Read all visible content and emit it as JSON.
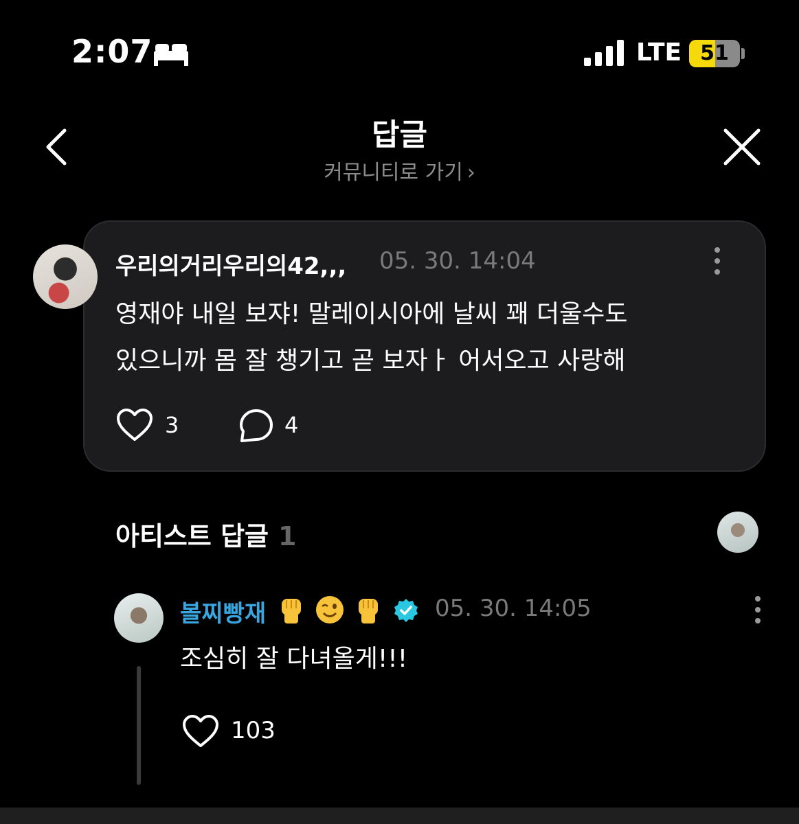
{
  "status_bar": {
    "time": "2:07",
    "network": "LTE",
    "battery": "51",
    "battery_level": 0.51,
    "icons": [
      "bed-icon",
      "signal-icon",
      "battery-icon"
    ]
  },
  "header": {
    "title": "답글",
    "subtitle": "커뮤니티로 가기",
    "subtitle_chevron": "›",
    "icons": [
      "back-icon",
      "close-icon"
    ]
  },
  "comment": {
    "username": "우리의거리우리의42,,,",
    "timestamp": "05. 30. 14:04",
    "body_line1": "영재야 내일 보쟈! 말레이시아에 날씨 꽤 더울수도",
    "body_line2": "있으니까 몸 잘 챙기고 곧 보자ㅏ 어서오고 사랑해",
    "likes": "3",
    "replies": "4"
  },
  "artist_section": {
    "title": "아티스트 답글",
    "count": "1"
  },
  "artist_reply": {
    "username": "볼찌빵재",
    "emojis": [
      "fist-emoji",
      "wink-emoji",
      "fist-emoji"
    ],
    "timestamp": "05. 30. 14:05",
    "body": "조심히 잘 다녀올게!!!",
    "likes": "103"
  },
  "colors": {
    "background": "#000000",
    "card": "#1c1c1e",
    "artist_name": "#3aa6e0",
    "muted": "#7a7a7a",
    "battery": "#f5d90a"
  }
}
